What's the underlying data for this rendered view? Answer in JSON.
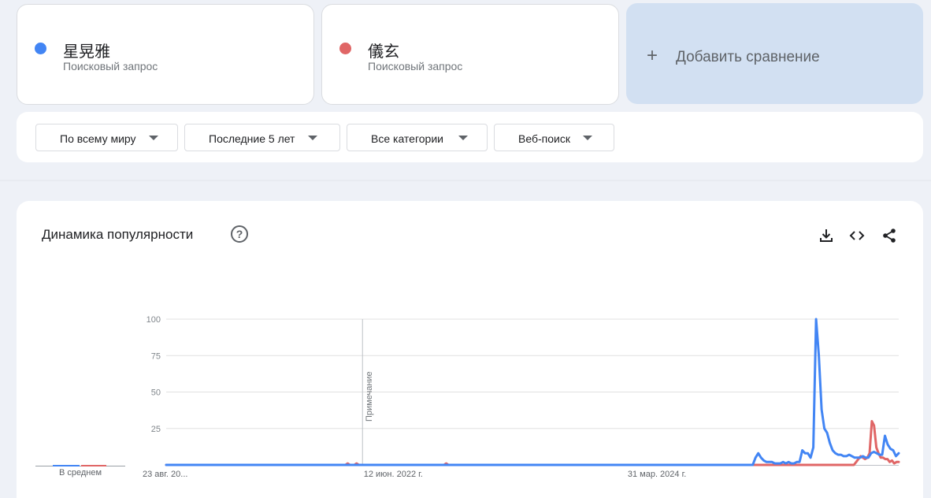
{
  "terms": [
    {
      "name": "星晃雅",
      "subtitle": "Поисковый запрос",
      "color": "#4285f4"
    },
    {
      "name": "儀玄",
      "subtitle": "Поисковый запрос",
      "color": "#e06666"
    }
  ],
  "add_comparison": {
    "label": "Добавить сравнение"
  },
  "filters": [
    {
      "label": "По всему миру"
    },
    {
      "label": "Последние 5 лет"
    },
    {
      "label": "Все категории"
    },
    {
      "label": "Веб-поиск"
    }
  ],
  "interest_card": {
    "title": "Динамика популярности",
    "help_icon": "help-icon",
    "tools": [
      "download-icon",
      "embed-icon",
      "share-icon"
    ],
    "average_label": "В среднем",
    "note_label": "Примечание"
  },
  "chart_data": {
    "type": "line",
    "x_tick_labels": [
      "23 авг. 20...",
      "12 июн. 2022 г.",
      "31 мар. 2024 г."
    ],
    "y_ticks": [
      25,
      50,
      75,
      100
    ],
    "ylim": [
      0,
      100
    ],
    "grid": true,
    "series": [
      {
        "name": "星晃雅",
        "color": "#4285f4",
        "average": 3,
        "values": [
          0,
          0,
          0,
          0,
          0,
          0,
          0,
          0,
          0,
          0,
          0,
          0,
          0,
          0,
          0,
          0,
          0,
          0,
          0,
          0,
          0,
          0,
          0,
          0,
          0,
          0,
          0,
          0,
          0,
          0,
          0,
          0,
          0,
          0,
          0,
          0,
          0,
          0,
          0,
          0,
          0,
          0,
          0,
          0,
          0,
          0,
          0,
          0,
          0,
          0,
          0,
          0,
          0,
          0,
          0,
          0,
          0,
          0,
          0,
          0,
          0,
          0,
          0,
          0,
          0,
          0,
          0,
          0,
          0,
          0,
          0,
          0,
          0,
          0,
          0,
          0,
          0,
          0,
          0,
          0,
          0,
          0,
          0,
          0,
          0,
          0,
          0,
          0,
          0,
          0,
          0,
          0,
          0,
          0,
          0,
          0,
          0,
          0,
          0,
          0,
          0,
          0,
          0,
          0,
          0,
          0,
          0,
          0,
          0,
          0,
          0,
          0,
          0,
          0,
          0,
          0,
          0,
          0,
          0,
          0,
          0,
          0,
          0,
          0,
          0,
          0,
          0,
          0,
          0,
          0,
          0,
          0,
          0,
          0,
          0,
          0,
          0,
          0,
          0,
          0,
          0,
          0,
          0,
          0,
          0,
          0,
          0,
          0,
          0,
          0,
          0,
          0,
          0,
          0,
          0,
          0,
          0,
          0,
          0,
          0,
          0,
          0,
          0,
          0,
          0,
          0,
          0,
          0,
          0,
          0,
          0,
          0,
          0,
          0,
          0,
          0,
          0,
          0,
          0,
          0,
          0,
          0,
          0,
          0,
          0,
          0,
          0,
          0,
          0,
          0,
          0,
          0,
          0,
          0,
          0,
          0,
          0,
          0,
          0,
          0,
          0,
          0,
          0,
          0,
          0,
          0,
          0,
          0,
          0,
          0,
          0,
          0,
          0,
          0,
          5,
          8,
          5,
          3,
          2,
          2,
          2,
          1,
          1,
          1,
          2,
          1,
          2,
          1,
          1,
          2,
          2,
          10,
          8,
          8,
          5,
          12,
          100,
          75,
          38,
          25,
          22,
          15,
          10,
          8,
          7,
          7,
          6,
          6,
          7,
          6,
          5,
          5,
          5,
          6,
          5,
          5,
          8,
          9,
          8,
          7,
          7,
          20,
          14,
          11,
          10,
          6,
          8
        ]
      },
      {
        "name": "儀玄",
        "color": "#e06666",
        "average": 1,
        "values": [
          0,
          0,
          0,
          0,
          0,
          0,
          0,
          0,
          0,
          0,
          0,
          0,
          0,
          0,
          0,
          0,
          0,
          0,
          0,
          0,
          0,
          0,
          0,
          0,
          0,
          0,
          0,
          0,
          0,
          0,
          0,
          0,
          0,
          0,
          0,
          0,
          0,
          0,
          0,
          0,
          0,
          0,
          0,
          0,
          0,
          0,
          0,
          0,
          0,
          0,
          0,
          0,
          0,
          0,
          0,
          0,
          0,
          0,
          0,
          0,
          0,
          0,
          0,
          0,
          0,
          0,
          0,
          0,
          0,
          0,
          0,
          0,
          0,
          0,
          0,
          0,
          0,
          0,
          0,
          0,
          0,
          1,
          0,
          0,
          0,
          1,
          0,
          0,
          0,
          0,
          0,
          0,
          0,
          0,
          0,
          0,
          0,
          0,
          0,
          0,
          0,
          0,
          0,
          0,
          0,
          0,
          0,
          0,
          0,
          0,
          0,
          0,
          0,
          0,
          0,
          0,
          0,
          0,
          0,
          0,
          0,
          0,
          0,
          0,
          0,
          1,
          0,
          0,
          0,
          0,
          0,
          0,
          0,
          0,
          0,
          0,
          0,
          0,
          0,
          0,
          0,
          0,
          0,
          0,
          0,
          0,
          0,
          0,
          0,
          0,
          0,
          0,
          0,
          0,
          0,
          0,
          0,
          0,
          0,
          0,
          0,
          0,
          0,
          0,
          0,
          0,
          0,
          0,
          0,
          0,
          0,
          0,
          0,
          0,
          0,
          0,
          0,
          0,
          0,
          0,
          0,
          0,
          0,
          0,
          0,
          0,
          0,
          0,
          0,
          0,
          0,
          0,
          0,
          0,
          0,
          0,
          0,
          0,
          0,
          0,
          0,
          0,
          0,
          0,
          0,
          0,
          0,
          0,
          0,
          0,
          0,
          0,
          0,
          0,
          0,
          0,
          0,
          0,
          0,
          0,
          0,
          0,
          0,
          0,
          0,
          0,
          0,
          0,
          0,
          0,
          0,
          0,
          0,
          0,
          0,
          0,
          0,
          0,
          0,
          0,
          0,
          0,
          0,
          0,
          0,
          0,
          0,
          0,
          0,
          0,
          0,
          0,
          0,
          0,
          0,
          0,
          0,
          0,
          0,
          0,
          0,
          0,
          0,
          0,
          0,
          0,
          0,
          0,
          0,
          0,
          0,
          0,
          0,
          0,
          0,
          0,
          0,
          0,
          0,
          0,
          0,
          0,
          0,
          0,
          0,
          0,
          0,
          0,
          0,
          0,
          0,
          0,
          0,
          0,
          0,
          0,
          0,
          0,
          0,
          0,
          0,
          0,
          0,
          0,
          0,
          0,
          0,
          0,
          2,
          4,
          6,
          5,
          4,
          5,
          8,
          30,
          27,
          12,
          8,
          5,
          5,
          4,
          4,
          2,
          3,
          1,
          2,
          2
        ]
      }
    ]
  }
}
